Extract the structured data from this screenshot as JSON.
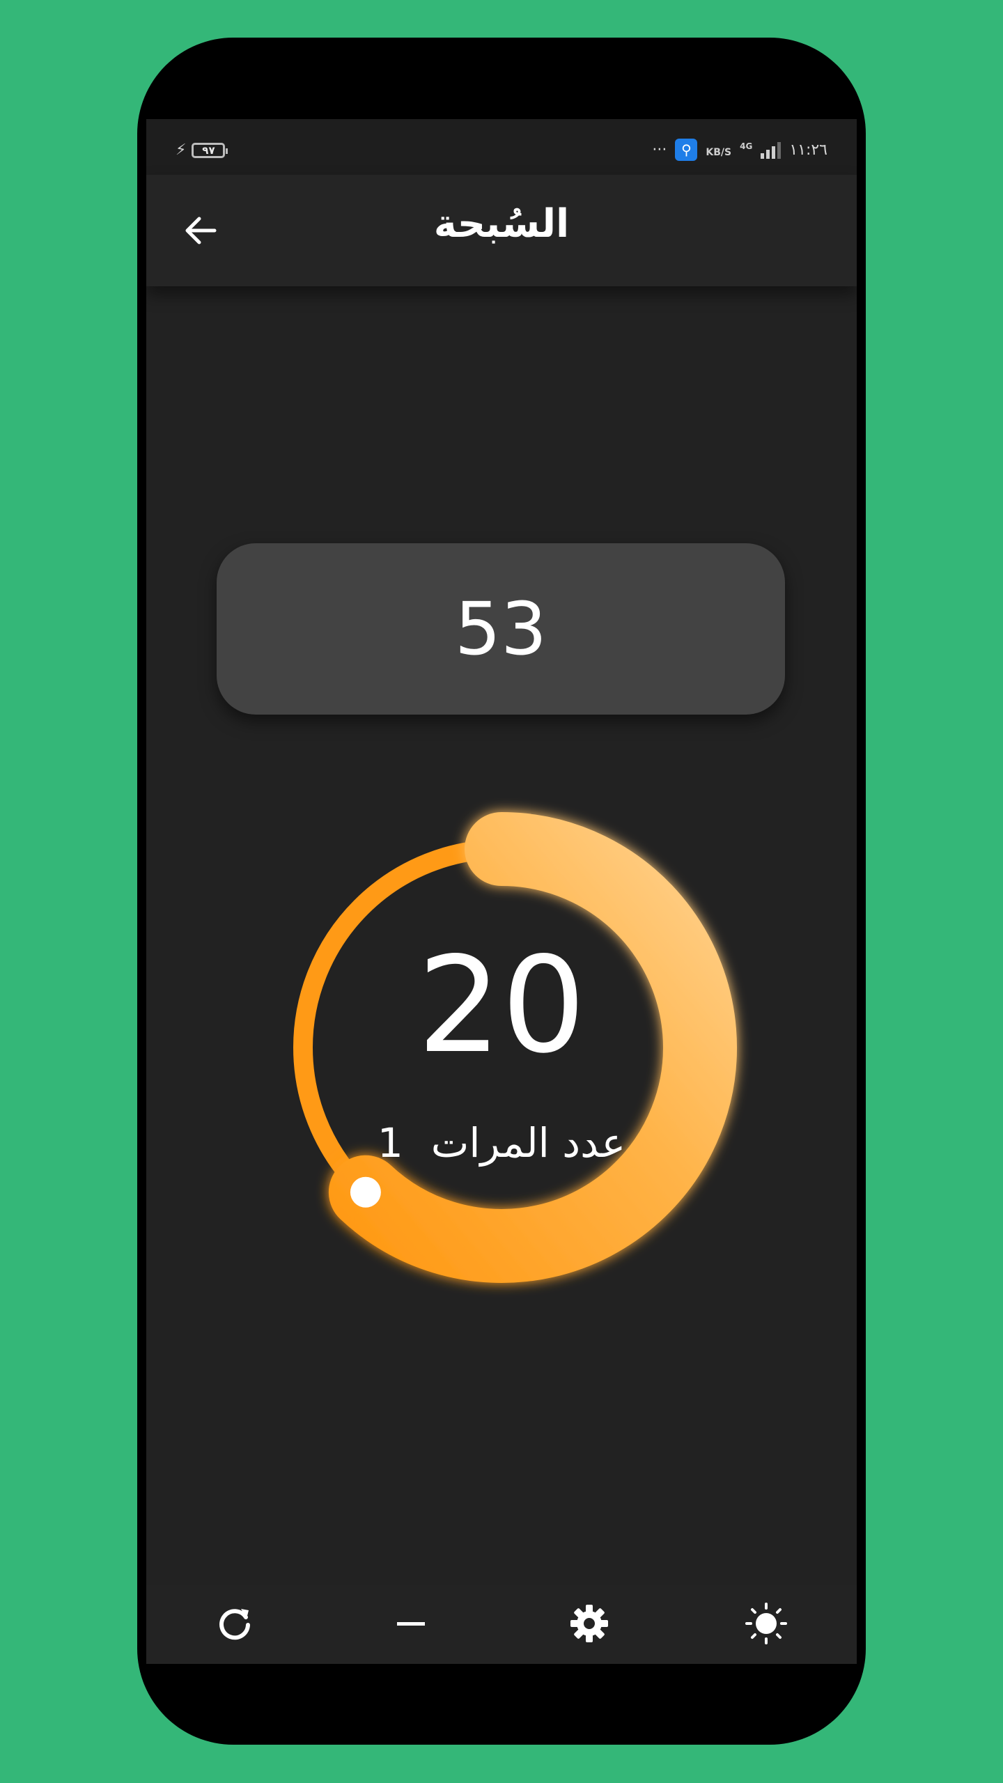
{
  "status_bar": {
    "battery_level": "٩٧",
    "network_speed_unit": "KB/S",
    "network_type": "4G",
    "time": "١١:٢٦",
    "overflow": "···"
  },
  "app_bar": {
    "title": "السُبحة",
    "back_icon": "arrow-left-icon"
  },
  "counter": {
    "total": "53",
    "current": "20",
    "rounds_label": "عدد المرات",
    "rounds_value": "1",
    "progress_fraction": 0.62
  },
  "toolbar": {
    "icons": [
      "refresh-icon",
      "minus-icon",
      "gear-icon",
      "brightness-icon"
    ]
  },
  "colors": {
    "accent": "#ff9a16",
    "accent_light": "#ffcf86",
    "background": "#222222",
    "card": "#434343",
    "frame": "#34b778"
  }
}
